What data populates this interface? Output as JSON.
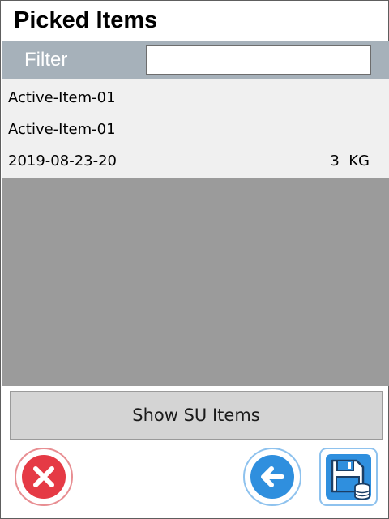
{
  "header": {
    "title": "Picked Items"
  },
  "filter": {
    "label": "Filter",
    "value": ""
  },
  "list": {
    "items": [
      {
        "line1": "Active-Item-01",
        "line2": "Active-Item-01",
        "line3": "2019-08-23-20",
        "quantity": "3  KG"
      }
    ]
  },
  "actions": {
    "show_su_label": "Show SU Items"
  },
  "icons": {
    "cancel": "close-icon",
    "back": "arrow-left-icon",
    "save": "save-database-icon"
  },
  "colors": {
    "header_bar": "#a6b1ba",
    "list_background": "#9b9b9b",
    "cancel_red": "#e53a45",
    "primary_blue": "#2f8fde"
  }
}
